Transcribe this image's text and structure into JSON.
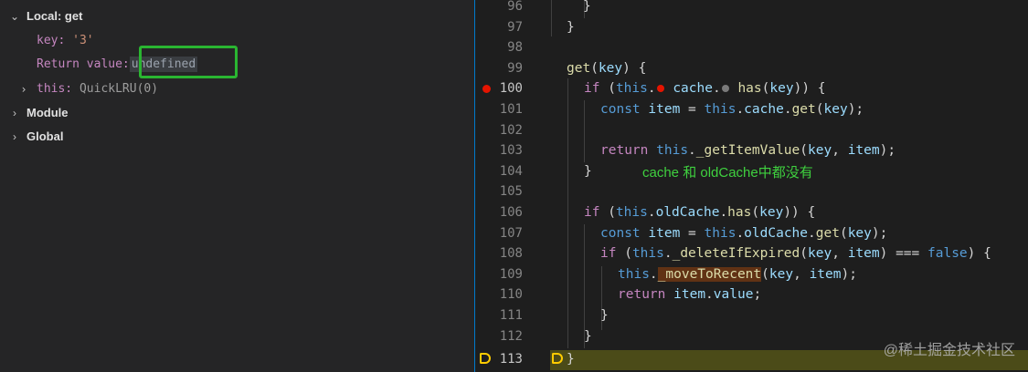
{
  "variables": {
    "local_scope": "Local: get",
    "key": {
      "name": "key:",
      "value": "'3'"
    },
    "return_value": {
      "name": "Return value:",
      "value": "undefined"
    },
    "this_var": {
      "name": "this:",
      "value": "QuickLRU(0)"
    },
    "module_scope": "Module",
    "global_scope": "Global"
  },
  "code": {
    "line_numbers": [
      "96",
      "97",
      "98",
      "99",
      "100",
      "101",
      "102",
      "103",
      "104",
      "105",
      "106",
      "107",
      "108",
      "109",
      "110",
      "111",
      "112",
      "113"
    ],
    "current_line": "113",
    "breakpoint_line": "100",
    "annotation": "cache 和 oldCache中都没有"
  },
  "watermark": "@稀土掘金技术社区",
  "colors": {
    "breakpoint": "#e51400",
    "current_line_arrow": "#ffcc00",
    "highlight_box": "#2ab531",
    "annotation": "#3fd13f"
  }
}
